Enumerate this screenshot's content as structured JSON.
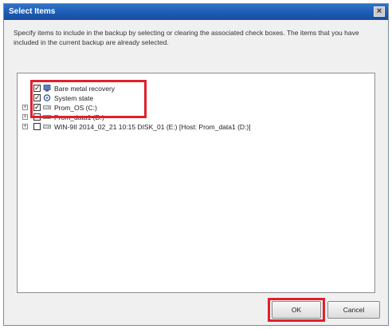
{
  "dialog": {
    "title": "Select Items",
    "close_glyph": "×",
    "instructions": "Specify items to include in the backup by selecting or clearing the associated check boxes. The items that you have included in the current backup are already selected."
  },
  "tree": {
    "items": [
      {
        "label": "Bare metal recovery",
        "checked": true,
        "icon": "bare-metal-icon"
      },
      {
        "label": "System state",
        "checked": true,
        "icon": "system-state-icon"
      },
      {
        "label": "Prom_OS (C:)",
        "checked": true,
        "icon": "drive-icon"
      },
      {
        "label": "Prom_data1 (D:)",
        "checked": false,
        "icon": "drive-icon"
      },
      {
        "label": "WIN-9II 2014_02_21 10:15 DISK_01 (E:) [Host: Prom_data1 (D:)]",
        "checked": false,
        "icon": "drive-icon"
      }
    ],
    "expand_glyph": "+"
  },
  "buttons": {
    "ok_label": "OK",
    "cancel_label": "Cancel"
  },
  "colors": {
    "highlight": "#e0202c",
    "titlebar": "#1d5cb3"
  }
}
